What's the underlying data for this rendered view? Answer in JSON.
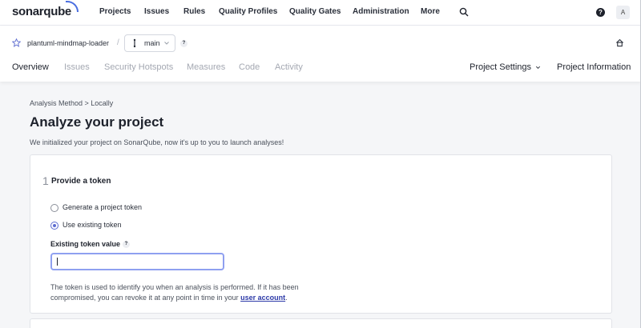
{
  "brand": {
    "logo_text": "sonarqube",
    "accent": "#4a6ee0"
  },
  "topnav": {
    "items": [
      "Projects",
      "Issues",
      "Rules",
      "Quality Profiles",
      "Quality Gates",
      "Administration",
      "More"
    ],
    "help_glyph": "?",
    "avatar_letter": "A"
  },
  "project": {
    "name": "plantuml-mindmap-loader",
    "separator": "/",
    "branch": "main",
    "branch_help": "?"
  },
  "tabs": {
    "items": [
      "Overview",
      "Issues",
      "Security Hotspots",
      "Measures",
      "Code",
      "Activity"
    ],
    "active": "Overview",
    "settings_label": "Project Settings",
    "info_label": "Project Information"
  },
  "main": {
    "breadcrumb": "Analysis Method > Locally",
    "title": "Analyze your project",
    "description": "We initialized your project on SonarQube, now it's up to you to launch analyses!"
  },
  "step1": {
    "number": "1",
    "title": "Provide a token",
    "options": [
      {
        "label": "Generate a project token",
        "checked": false
      },
      {
        "label": "Use existing token",
        "checked": true
      }
    ],
    "field_label": "Existing token value",
    "field_help": "?",
    "field_value": "",
    "help_text_before": "The token is used to identify you when an analysis is performed. If it has been compromised, you can revoke it at any point in time in your ",
    "help_link": "user account",
    "help_text_after": "."
  }
}
